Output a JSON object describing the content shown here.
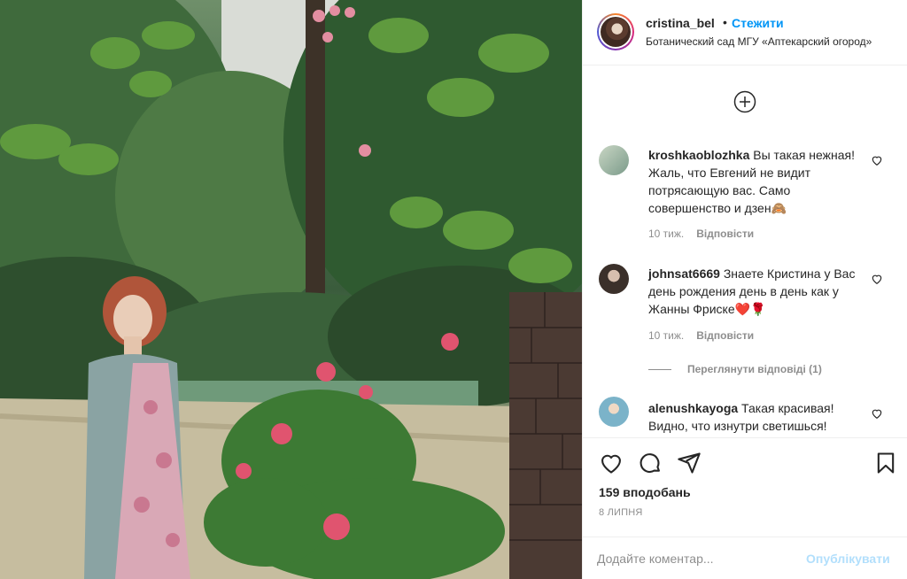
{
  "post": {
    "username": "cristina_bel",
    "separator": "•",
    "follow_label": "Стежити",
    "location": "Ботанический сад МГУ «Аптекарский огород»"
  },
  "comments": [
    {
      "username": "kroshkaoblozhka",
      "text": "Вы такая нежная! Жаль, что Евгений не видит потрясающую вас. Само совершенство и дзен🙈",
      "age": "10 тиж.",
      "reply_label": "Відповісти"
    },
    {
      "username": "johnsat6669",
      "text": "Знаете Кристина у Вас день рождения день в день как у Жанны Фриске❤️🌹",
      "age": "10 тиж.",
      "reply_label": "Відповісти"
    },
    {
      "username": "alenushkayoga",
      "text": "Такая красивая! Видно, что изнутри светишься!",
      "age": "",
      "reply_label": ""
    }
  ],
  "view_replies_label": "Переглянути відповіді (1)",
  "likes": "159 вподобань",
  "date": "8 ЛИПНЯ",
  "comment_box": {
    "placeholder": "Додайте коментар...",
    "publish_label": "Опублікувати"
  },
  "colors": {
    "accent": "#0095f6",
    "publish_disabled": "#b2dffc",
    "muted": "#8e8e8e",
    "text": "#262626"
  }
}
